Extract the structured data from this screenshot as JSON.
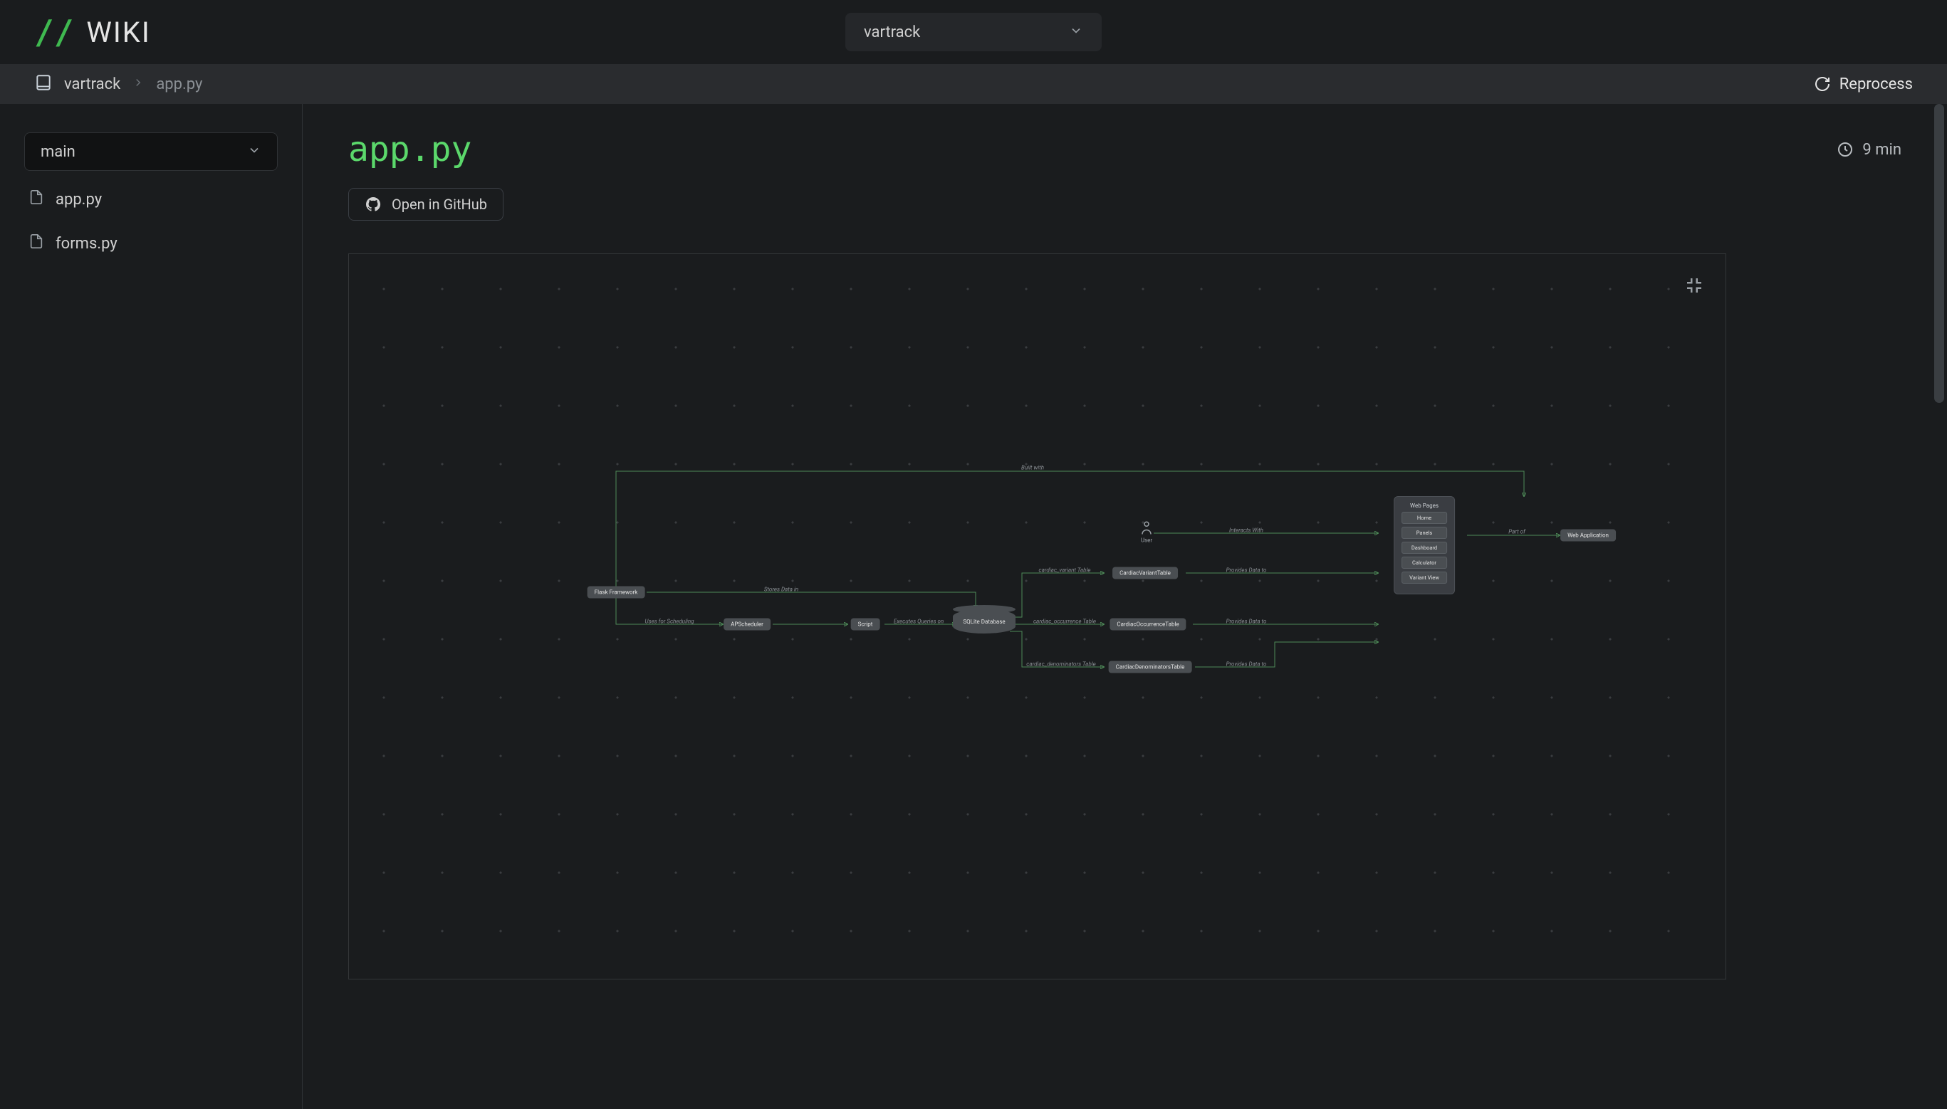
{
  "header": {
    "brand": "WIKI",
    "project_selected": "vartrack"
  },
  "breadcrumb": {
    "repo": "vartrack",
    "file": "app.py",
    "reprocess_label": "Reprocess"
  },
  "sidebar": {
    "branch": "main",
    "files": [
      "app.py",
      "forms.py"
    ]
  },
  "page": {
    "title": "app.py",
    "read_time": "9 min",
    "open_github_label": "Open in GitHub"
  },
  "diagram": {
    "group": {
      "title": "Web Pages",
      "items": [
        "Home",
        "Panels",
        "Dashboard",
        "Calculator",
        "Variant View"
      ]
    },
    "nodes": {
      "flask": "Flask Framework",
      "apscheduler": "APScheduler",
      "script": "Script",
      "sqlite": "SQLite Database",
      "cvt": "CardiacVariantTable",
      "cot": "CardiacOccurrenceTable",
      "cdt": "CardiacDenominatorsTable",
      "webapp": "Web Application",
      "user": "User"
    },
    "edge_labels": {
      "built_with": "Built with",
      "uses_sched": "Uses for Scheduling",
      "stores_data": "Stores Data in",
      "exec_queries": "Executes Queries on",
      "cv_table": "cardiac_variant Table",
      "co_table": "cardiac_occurrence Table",
      "cd_table": "cardiac_denominators Table",
      "provides_data": "Provides Data to",
      "interacts": "Interacts With",
      "part_of": "Part of"
    }
  }
}
